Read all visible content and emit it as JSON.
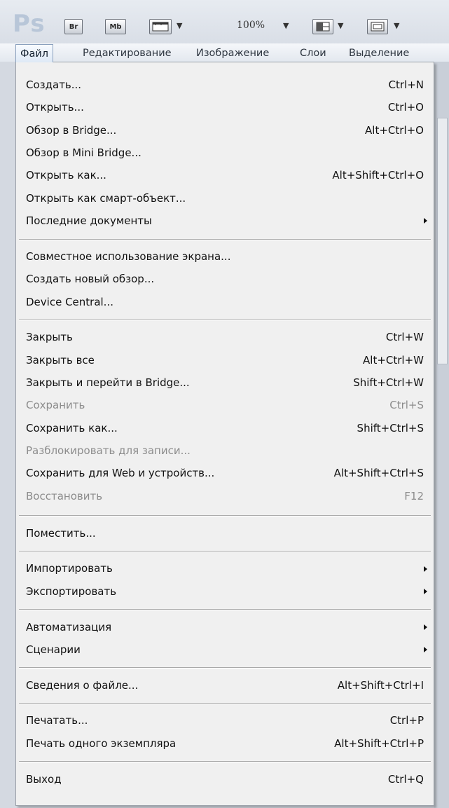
{
  "app": {
    "logo": "Ps",
    "toolbar": {
      "br_label": "Br",
      "mb_label": "Mb",
      "zoom": "100%",
      "caret": "▼"
    }
  },
  "menubar": {
    "items": [
      {
        "label": "Файл",
        "active": true
      },
      {
        "label": "Редактирование"
      },
      {
        "label": "Изображение"
      },
      {
        "label": "Слои"
      },
      {
        "label": "Выделение"
      }
    ]
  },
  "menu": {
    "items": [
      {
        "label": "Создать...",
        "shortcut": "Ctrl+N"
      },
      {
        "label": "Открыть...",
        "shortcut": "Ctrl+O"
      },
      {
        "label": "Обзор в Bridge...",
        "shortcut": "Alt+Ctrl+O"
      },
      {
        "label": "Обзор в Mini Bridge...",
        "shortcut": ""
      },
      {
        "label": "Открыть как...",
        "shortcut": "Alt+Shift+Ctrl+O"
      },
      {
        "label": "Открыть как смарт-объект...",
        "shortcut": ""
      },
      {
        "label": "Последние документы",
        "shortcut": "",
        "submenu": true
      },
      {
        "label": "Совместное использование экрана...",
        "shortcut": ""
      },
      {
        "label": "Создать новый обзор...",
        "shortcut": ""
      },
      {
        "label": "Device Central...",
        "shortcut": ""
      },
      {
        "label": "Закрыть",
        "shortcut": "Ctrl+W"
      },
      {
        "label": "Закрыть все",
        "shortcut": "Alt+Ctrl+W"
      },
      {
        "label": "Закрыть и перейти в Bridge...",
        "shortcut": "Shift+Ctrl+W"
      },
      {
        "label": "Сохранить",
        "shortcut": "Ctrl+S",
        "disabled": true
      },
      {
        "label": "Сохранить как...",
        "shortcut": "Shift+Ctrl+S"
      },
      {
        "label": "Разблокировать для записи...",
        "shortcut": "",
        "disabled": true
      },
      {
        "label": "Сохранить для Web и устройств...",
        "shortcut": "Alt+Shift+Ctrl+S"
      },
      {
        "label": "Восстановить",
        "shortcut": "F12",
        "disabled": true
      },
      {
        "label": "Поместить...",
        "shortcut": ""
      },
      {
        "label": "Импортировать",
        "shortcut": "",
        "submenu": true
      },
      {
        "label": "Экспортировать",
        "shortcut": "",
        "submenu": true
      },
      {
        "label": "Автоматизация",
        "shortcut": "",
        "submenu": true
      },
      {
        "label": "Сценарии",
        "shortcut": "",
        "submenu": true
      },
      {
        "label": "Сведения о файле...",
        "shortcut": "Alt+Shift+Ctrl+I"
      },
      {
        "label": "Печатать...",
        "shortcut": "Ctrl+P"
      },
      {
        "label": "Печать одного экземпляра",
        "shortcut": "Alt+Shift+Ctrl+P"
      },
      {
        "label": "Выход",
        "shortcut": "Ctrl+Q"
      }
    ]
  },
  "colors": {
    "menu_bg": "#f0f0f0",
    "disabled_text": "#8c8c8c",
    "text": "#111111"
  }
}
